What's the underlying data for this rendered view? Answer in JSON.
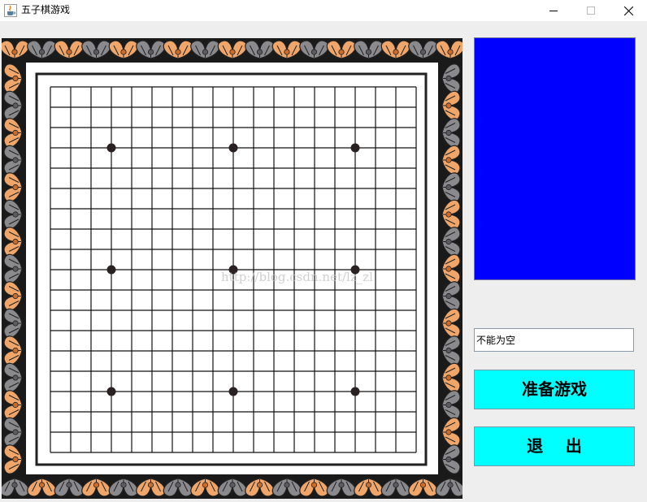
{
  "window": {
    "title": "五子棋游戏",
    "icon": "java-cup-icon",
    "controls": [
      "minimize-icon",
      "maximize-icon",
      "close-icon"
    ]
  },
  "board": {
    "lines": 19,
    "star_points": [
      [
        3,
        3
      ],
      [
        3,
        9
      ],
      [
        3,
        15
      ],
      [
        9,
        3
      ],
      [
        9,
        9
      ],
      [
        9,
        15
      ],
      [
        15,
        3
      ],
      [
        15,
        9
      ],
      [
        15,
        15
      ]
    ],
    "watermark": "http://blog.csdn.net/lz_zl",
    "colors": {
      "frame": "#1a1a1a",
      "petal_orange": "#f0a66a",
      "petal_gray": "#8a8a8e",
      "grid": "#111111",
      "paper": "#ffffff"
    }
  },
  "side": {
    "panel_color": "#0000ff",
    "name_field_value": "不能为空",
    "ready_label": "准备游戏",
    "exit_label": "退    出",
    "button_color": "#00ffff"
  }
}
